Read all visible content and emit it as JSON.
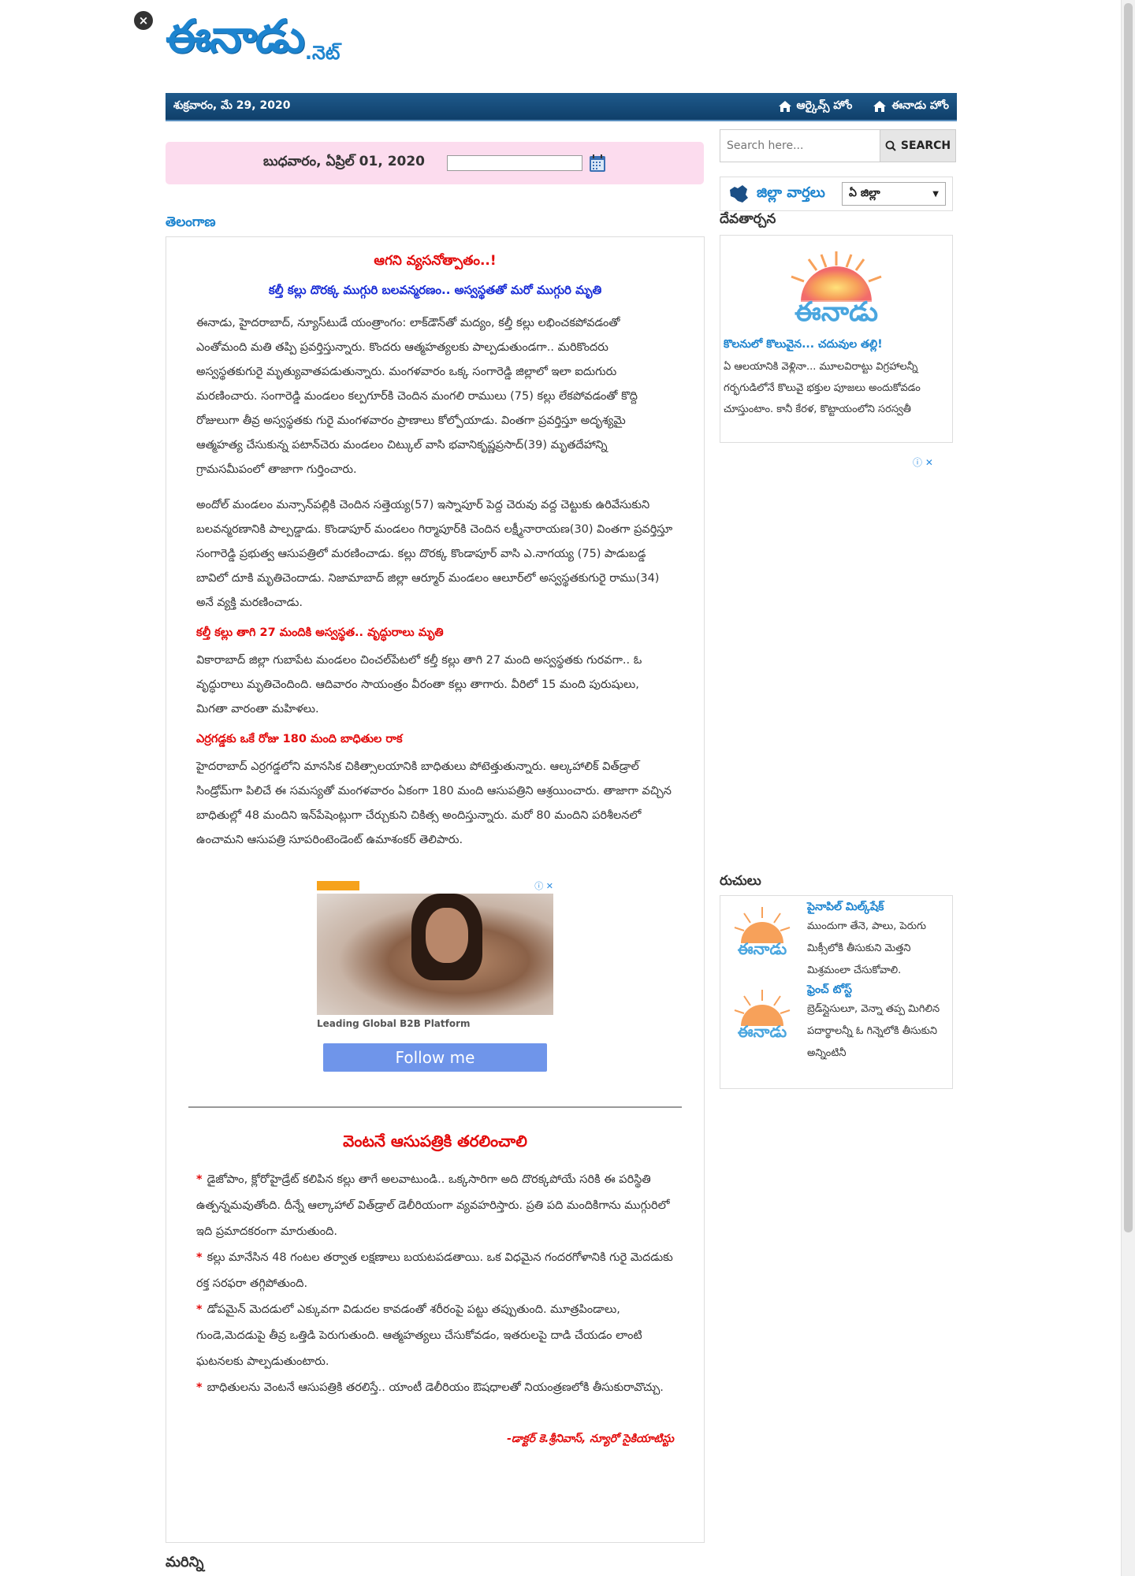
{
  "header": {
    "logo_main": "ఈనాడు",
    "logo_suffix": ".నెట్",
    "date": "శుక్రవారం, మే 29, 2020",
    "nav": [
      {
        "label": "ఆర్కైవ్స్ హోం"
      },
      {
        "label": "ఈనాడు హోం"
      }
    ]
  },
  "archive": {
    "selected_date": "బుధవారం, ఏప్రిల్ 01, 2020"
  },
  "section": {
    "title": "తెలంగాణ"
  },
  "article": {
    "title": "ఆగని వ్యసనోత్పాతం..!",
    "subtitle": "కల్తీ కల్లు దొరక్క ముగ్గురి బలవన్మరణం.. అస్వస్థతతో మరో ముగ్గురి మృతి",
    "para1": "ఈనాడు, హైదరాబాద్‌, న్యూస్‌టుడే యంత్రాంగం: లాక్‌డౌన్‌తో మద్యం, కల్తీ కల్లు లభించకపోవడంతో ఎంతోమంది మతి తప్పి ప్రవర్తిస్తున్నారు. కొందరు ఆత్మహత్యలకు పాల్పడుతుండగా.. మరికొందరు అస్వస్థతకుగురై మృత్యువాతపడుతున్నారు. మంగళవారం ఒక్క సంగారెడ్డి జిల్లాలో ఇలా ఐదుగురు మరణించారు. సంగారెడ్డి మండలం కల్పగూర్‌కి చెందిన మంగలి రాములు (75) కల్లు లేకపోవడంతో కొద్ది రోజులుగా తీవ్ర అస్వస్థతకు గురై మంగళవారం ప్రాణాలు కోల్పోయాడు. వింతగా ప్రవర్తిస్తూ అదృశ్యమై ఆత్మహత్య చేసుకున్న పటాన్‌చెరు మండలం చిట్కుల్‌ వాసి భవానికృష్ణప్రసాద్‌(39) మృతదేహాన్ని గ్రామసమీపంలో తాజాగా గుర్తించారు.",
    "para2": "అందోల్‌ మండలం మన్సాన్‌పల్లికి చెందిన సత్తెయ్య(57) ఇస్నాపూర్‌ పెద్ద చెరువు వద్ద చెట్టుకు ఉరివేసుకుని బలవన్మరణానికి పాల్పడ్డాడు. కొండాపూర్‌ మండలం గిర్మాపూర్‌కి చెందిన లక్ష్మీనారాయణ(30) వింతగా ప్రవర్తిస్తూ సంగారెడ్డి ప్రభుత్వ ఆసుపత్రిలో మరణించాడు. కల్లు దొరక్క కొండాపూర్‌ వాసి ఎ.నాగయ్య (75) పాడుబడ్డ బావిలో దూకి మృతిచెందాడు. నిజామాబాద్‌ జిల్లా ఆర్మూర్‌ మండలం ఆలూర్‌లో అస్వస్థతకుగురై రాము(34) అనే వ్యక్తి మరణించాడు.",
    "head2": "కల్తీ కల్లు తాగి 27 మందికి అస్వస్థత.. వృద్ధురాలు మృతి",
    "para3": "వికారాబాద్‌ జిల్లా గుబాపేట మండలం చించల్‌పేటలో కల్తీ కల్లు తాగి 27 మంది అస్వస్థతకు గురవగా.. ఓ వృద్ధురాలు మృతిచెందింది. ఆదివారం సాయంత్రం వీరంతా కల్లు తాగారు. వీరిలో 15 మంది పురుషులు, మిగతా వారంతా మహిళలు.",
    "head3": "ఎర్రగడ్డకు ఒకే రోజు 180 మంది బాధితుల రాక",
    "para4": "హైదరాబాద్‌ ఎర్రగడ్డలోని మానసిక చికిత్సాలయానికి బాధితులు పోటెత్తుతున్నారు. ఆల్కహాలిక్‌ విత్‌డ్రాల్‌ సిండ్రోమ్‌గా పిలిచే ఈ సమస్యతో మంగళవారం ఏకంగా 180 మంది ఆసుపత్రిని ఆశ్రయించారు. తాజాగా వచ్చిన బాధితుల్లో 48 మందిని ఇన్‌పేషెంట్లుగా చేర్చుకుని చికిత్స అందిస్తున్నారు. మరో 80 మందిని పరిశీలనలో ఉంచామని ఆసుపత్రి సూపరింటెండెంట్‌ ఉమాశంకర్‌ తెలిపారు."
  },
  "ad": {
    "caption": "Leading Global B2B Platform",
    "button": "Follow me"
  },
  "article2": {
    "title": "వెంటనే ఆసుపత్రికి తరలించాలి",
    "bullets": [
      "డైజోపాం, క్లోరోహైడ్రేట్‌ కలిపిన కల్లు తాగే అలవాటుండి.. ఒక్కసారిగా అది దొరక్కపోయే సరికి ఈ పరిస్థితి ఉత్పన్నమవుతోంది. దీన్నే ఆల్కాహాల్‌ విత్‌డ్రాల్‌ డెలీరియంగా వ్యవహరిస్తారు. ప్రతి పది మందికిగాను ముగ్గురిలో ఇది ప్రమాదకరంగా మారుతుంది.",
      "కల్లు మానేసిన 48 గంటల తర్వాత లక్షణాలు బయటపడతాయి. ఒక విధమైన గందరగోళానికి గురై మెదడుకు రక్త సరఫరా తగ్గిపోతుంది.",
      "డోపమైన్‌ మెదడులో ఎక్కువగా విడుదల కావడంతో శరీరంపై పట్టు తప్పుతుంది. మూత్రపిండాలు, గుండె,మెదడుపై తీవ్ర ఒత్తిడి పెరుగుతుంది. ఆత్మహత్యలు చేసుకోవడం, ఇతరులపై దాడి చేయడం లాంటి ఘటనలకు పాల్పడుతుంటారు.",
      "బాధితులను వెంటనే ఆసుపత్రికి తరలిస్తే.. యాంటీ డెలీరియం ఔషధాలతో నియంత్రణలోకి తీసుకురావొచ్చు."
    ],
    "signature": "-డాక్టర్‌ కె.శ్రీనివాస్‌, న్యూరో సైకియాటిస్టు"
  },
  "more": {
    "title": "మరిన్ని"
  },
  "sidebar": {
    "search_placeholder": "Search here...",
    "search_button": "SEARCH",
    "district_label": "జిల్లా వార్తలు",
    "district_select": "ఏ జిల్లా",
    "devotional_title": "దేవతార్చన",
    "devotional_link": "కొలనులో కొలువైన... చదువుల తల్లి!",
    "devotional_text": "ఏ ఆలయానికి వెళ్లినా... మూలవిరాట్టు విగ్రహాలన్నీ గర్భగుడిలోనే కొలువై భక్తుల పూజలు అందుకోవడం చూస్తుంటాం. కానీ కేరళ, కొట్టాయంలోని సరస్వతీ",
    "recipes_title": "రుచులు",
    "recipes": [
      {
        "name": "పైనాపిల్‌ మిల్క్‌షేక్‌",
        "desc": "ముందుగా తేనె, పాలు, పెరుగు మిక్సీలోకి తీసుకుని మెత్తని మిశ్రమంలా చేసుకోవాలి."
      },
      {
        "name": "ఫ్రెంచ్‌ టోస్ట్‌",
        "desc": "బ్రెడ్‌స్లైసులూ, వెన్నా తప్ప మిగిలిన పదార్థాలన్నీ ఓ గిన్నెలోకి తీసుకుని అన్నింటినీ"
      }
    ]
  },
  "colors": {
    "brand_blue": "#1d84cf",
    "nav_bar": "#0f3f6a",
    "headline_red": "#e30b0b",
    "subtitle_blue": "#1a2ed6",
    "date_box_pink": "#fcdcee"
  }
}
